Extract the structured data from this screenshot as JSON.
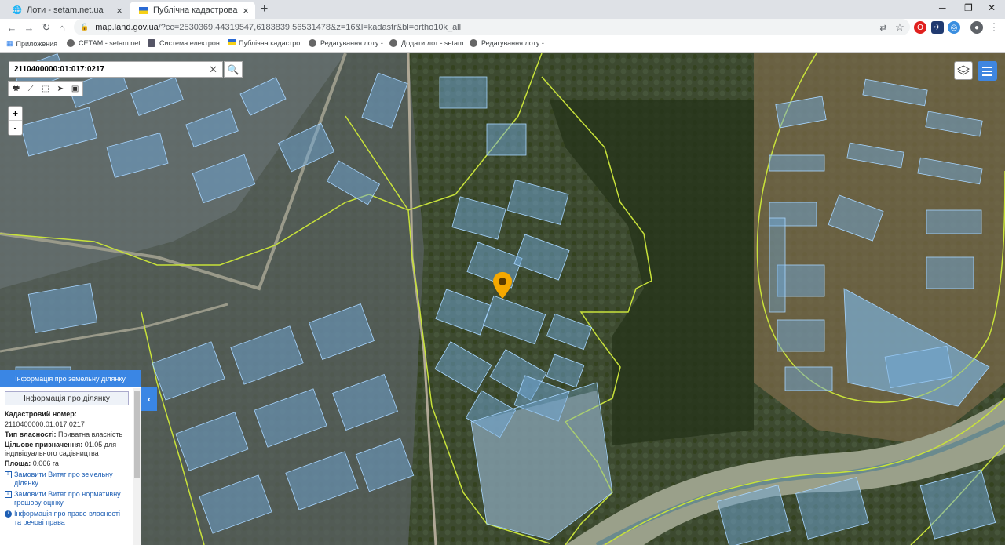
{
  "browser": {
    "tabs": [
      {
        "title": "Лоти - setam.net.ua",
        "favicon": "globe-icon",
        "active": false
      },
      {
        "title": "Публічна кадастрова карта України",
        "favicon": "ukraine-flag-icon",
        "active": true
      }
    ],
    "address": {
      "host": "map.land.gov.ua",
      "path": "/?cc=2530369.44319547,6183839.56531478&z=16&l=kadastr&bl=ortho10k_all"
    },
    "bookmarks": [
      {
        "label": "Приложения",
        "icon": "apps-grid-icon"
      },
      {
        "label": "СЕТАМ - setam.net...",
        "icon": "globe-icon"
      },
      {
        "label": "Система електрон...",
        "icon": "shield-icon"
      },
      {
        "label": "Публічна кадастро...",
        "icon": "ukraine-flag-icon"
      },
      {
        "label": "Редагування лоту -...",
        "icon": "globe-icon"
      },
      {
        "label": "Додати лот - setam...",
        "icon": "globe-icon"
      },
      {
        "label": "Редагування лоту -...",
        "icon": "globe-icon"
      }
    ]
  },
  "map": {
    "search_value": "2110400000:01:017:0217",
    "zoom_in": "+",
    "zoom_out": "-",
    "colors": {
      "parcel_fill": "#6fa8d8",
      "parcel_stroke": "#9fd2ff",
      "boundary": "#c8e23a",
      "accent": "#3a86e4",
      "marker": "#f5a800"
    }
  },
  "panel": {
    "header": "Інформація про земельну ділянку",
    "section_title": "Інформація про ділянку",
    "cadastral_label": "Кадастровий номер:",
    "cadastral_value": "2110400000:01:017:0217",
    "ownership_label": "Тип власності:",
    "ownership_value": "Приватна власність",
    "purpose_label": "Цільове призначення:",
    "purpose_value": "01.05 для індивідуального садівництва",
    "area_label": "Площа:",
    "area_value": "0.066 га",
    "links": [
      {
        "text": "Замовити Витяг про земельну ділянку",
        "icon": "document-icon"
      },
      {
        "text": "Замовити Витяг про нормативну грошову оцінку",
        "icon": "document-icon"
      },
      {
        "text": "Інформація про право власності та речові права",
        "icon": "info-icon"
      }
    ]
  }
}
